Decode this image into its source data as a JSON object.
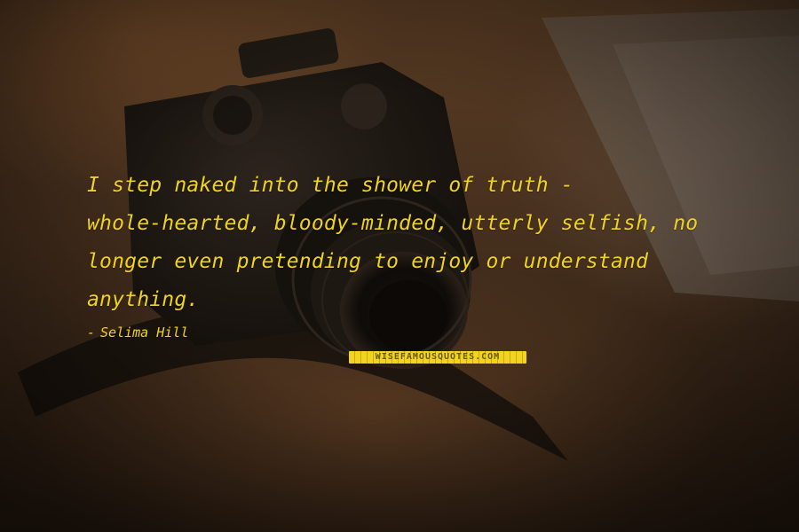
{
  "quote": {
    "lines": [
      "I step naked into the shower of truth -",
      "whole-hearted, bloody-minded, utterly selfish, no",
      "longer even pretending to enjoy or understand",
      "anything."
    ],
    "author": "Selima Hill",
    "author_prefix": "-"
  },
  "watermark": {
    "text": "WISEFAMOUSQUOTES.COM"
  },
  "colors": {
    "text": "#f0d31f",
    "background": "#3a2718"
  }
}
